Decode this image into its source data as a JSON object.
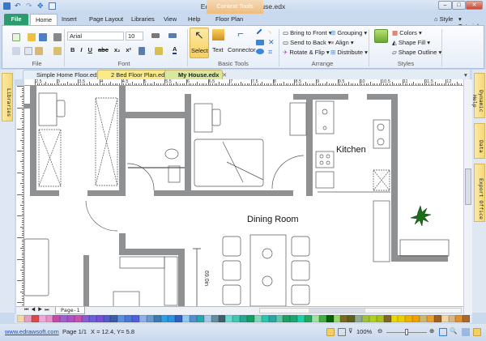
{
  "window": {
    "title": "Edraw Max - My House.edx",
    "context_tools": "Context Tools",
    "minimize": "–",
    "restore": "□",
    "close": "✕"
  },
  "quick_access": [
    "save-icon",
    "undo-icon",
    "redo-icon",
    "pointer-icon",
    "print-preview-icon"
  ],
  "menu_tabs": [
    "File",
    "Home",
    "Insert",
    "Page Layout",
    "Libraries",
    "View",
    "Help",
    "Floor Plan"
  ],
  "right_links": {
    "style": "Style",
    "tutorial": "Tutorial"
  },
  "ribbon": {
    "file_group": "File",
    "font_group": "Font",
    "font_name": "Arial",
    "font_size": "10",
    "font_buttons": [
      "B",
      "I",
      "U",
      "abc",
      "x₂",
      "x²"
    ],
    "basic_tools_group": "Basic Tools",
    "select": "Select",
    "text": "Text",
    "connector": "Connector",
    "arrange_group": "Arrange",
    "arrange": [
      "Bring to Front",
      "Send to Back",
      "Rotate & Flip",
      "Grouping",
      "Align",
      "Distribute"
    ],
    "styles_group": "Styles",
    "styles": [
      "Colors",
      "Shape Fill",
      "Shape Outline"
    ]
  },
  "doc_tabs": [
    {
      "label": "Simple Home Floor.edx"
    },
    {
      "label": "2 Bed Floor Plan.edx"
    },
    {
      "label": "My House.edx",
      "active": true
    }
  ],
  "side_panels": {
    "left": "Libraries",
    "right": [
      "Dynamic Help",
      "Data",
      "Export Office"
    ]
  },
  "ruler": {
    "labels": [
      "2.5",
      "3",
      "3.5",
      "4",
      "4.5",
      "5",
      "5.5",
      "6",
      "6.5",
      "7",
      "7.5",
      "8",
      "8.5",
      "9",
      "9.5",
      "10",
      "10.5",
      "11",
      "11.5",
      "12",
      "12.5"
    ]
  },
  "plan": {
    "kitchen": "Kitchen",
    "dining": "Dining Room",
    "dimension": "69.0in"
  },
  "page_tab": "Page-1",
  "palette": [
    "#f1d9a8",
    "#e7a0c0",
    "#e04848",
    "#f0a8d8",
    "#e890c8",
    "#c84aa8",
    "#a060d0",
    "#b050c8",
    "#c850b0",
    "#8a5cd0",
    "#6a60d8",
    "#7850d8",
    "#5858d0",
    "#3c5ca8",
    "#5a8ee0",
    "#4a78d8",
    "#5060e0",
    "#90b0e8",
    "#6a98d0",
    "#3c7cb0",
    "#2aa0e8",
    "#2c90e0",
    "#2c60c0",
    "#90c8f0",
    "#5090d0",
    "#28a8a8",
    "#a8c8e8",
    "#6090a0",
    "#40606a",
    "#68d8d0",
    "#40c8b0",
    "#28a890",
    "#10a060",
    "#80d8b8",
    "#28c8b0",
    "#28a8a0",
    "#60c8a8",
    "#20a060",
    "#18a870",
    "#20d0a8",
    "#20a860",
    "#a0e0a0",
    "#40b040",
    "#006400",
    "#98d868",
    "#7a6a20",
    "#606020",
    "#90a890",
    "#a0c040",
    "#b0d020",
    "#a8c020",
    "#806820",
    "#e8d800",
    "#e8d000",
    "#f0b000",
    "#f0a000",
    "#c8b870",
    "#e8a030",
    "#a06020",
    "#f0d8a8",
    "#d8b888",
    "#e09030",
    "#a86830"
  ],
  "status": {
    "link": "www.edrawsoft.com",
    "page": "Page 1/1",
    "coords": "X = 12.4, Y= 5.8",
    "zoom": "100%",
    "zoom_level": 0.5
  }
}
